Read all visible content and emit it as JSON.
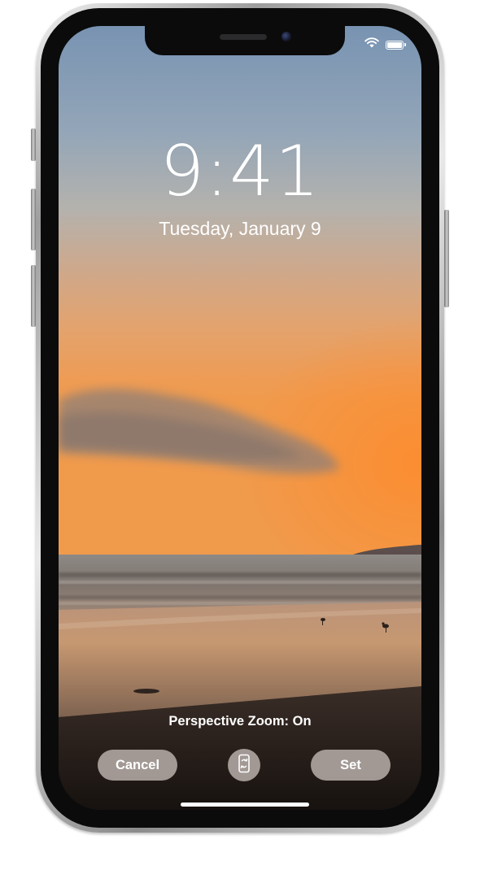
{
  "lock_screen": {
    "time": "9:41",
    "date": "Tuesday, January 9"
  },
  "status_bar": {
    "icons": [
      "wifi-icon",
      "battery-icon"
    ],
    "battery_level": 1.0
  },
  "wallpaper_preview": {
    "status_text": "Perspective Zoom: On",
    "cancel_label": "Cancel",
    "set_label": "Set",
    "toggle_icon": "perspective-zoom-icon"
  },
  "colors": {
    "sky_top": "#7f9bb8",
    "sky_horizon": "#eb9045",
    "button_fill": "#beb4b0",
    "text": "#ffffff"
  }
}
